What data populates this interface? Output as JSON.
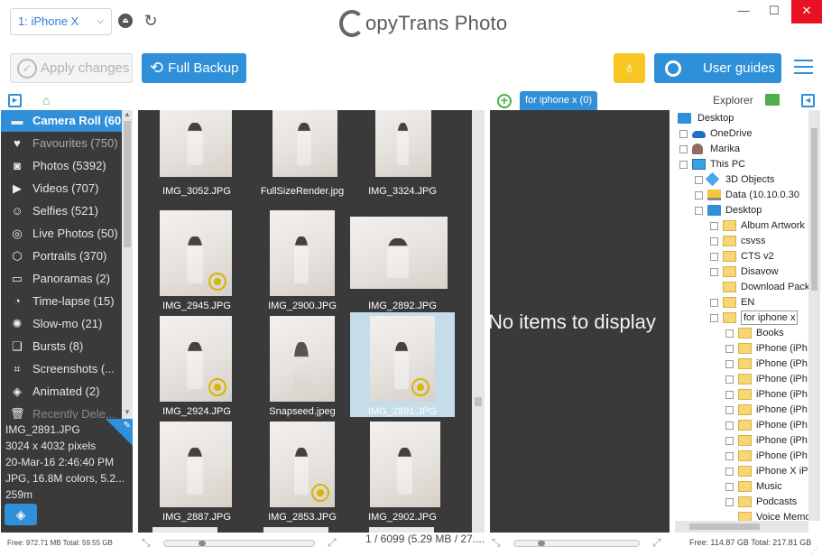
{
  "titlebar": {
    "device": "1: iPhone X",
    "logo_text": "opyTrans Photo",
    "minimize": "—",
    "maximize": "☐",
    "close": "✕"
  },
  "toolbar": {
    "apply_label": "Apply changes",
    "backup_label": "Full Backup",
    "guides_label": "User guides"
  },
  "subheader": {
    "album_tab": "for iphone x (0)",
    "explorer_label": "Explorer"
  },
  "sidebar": {
    "items": [
      {
        "label": "Camera Roll (60...",
        "icon": "camera-roll-icon",
        "glyph": "▬"
      },
      {
        "label": "Favourites (750)",
        "icon": "heart-icon",
        "glyph": "♥"
      },
      {
        "label": "Photos (5392)",
        "icon": "camera-icon",
        "glyph": "◙"
      },
      {
        "label": "Videos (707)",
        "icon": "video-icon",
        "glyph": "▶"
      },
      {
        "label": "Selfies (521)",
        "icon": "selfie-icon",
        "glyph": "☺"
      },
      {
        "label": "Live Photos (50)",
        "icon": "live-photo-icon",
        "glyph": "◎"
      },
      {
        "label": "Portraits (370)",
        "icon": "portrait-icon",
        "glyph": "⬡"
      },
      {
        "label": "Panoramas (2)",
        "icon": "panorama-icon",
        "glyph": "▭"
      },
      {
        "label": "Time-lapse (15)",
        "icon": "timelapse-icon",
        "glyph": "◔"
      },
      {
        "label": "Slow-mo (21)",
        "icon": "slowmo-icon",
        "glyph": "✺"
      },
      {
        "label": "Bursts (8)",
        "icon": "bursts-icon",
        "glyph": "❏"
      },
      {
        "label": "Screenshots (...",
        "icon": "screenshot-icon",
        "glyph": "⌗"
      },
      {
        "label": "Animated (2)",
        "icon": "animated-icon",
        "glyph": "◈"
      },
      {
        "label": "Recently Dele...",
        "icon": "trash-icon",
        "glyph": "🗑"
      }
    ]
  },
  "info": {
    "filename": "IMG_2891.JPG",
    "dimensions": "3024 x 4032 pixels",
    "date": "20-Mar-16 2:46:40 PM",
    "format": "JPG, 16.8M colors, 5.2...",
    "size": "259m",
    "storage": "Free: 972.71 MB Total: 59.55 GB"
  },
  "grid": {
    "photos": [
      {
        "name": "IMG_3052.JPG",
        "live": false,
        "selected": false
      },
      {
        "name": "FullSizeRender.jpg",
        "live": false,
        "selected": false
      },
      {
        "name": "IMG_3324.JPG",
        "live": false,
        "selected": false
      },
      {
        "name": "IMG_2945.JPG",
        "live": true,
        "selected": false
      },
      {
        "name": "IMG_2900.JPG",
        "live": false,
        "selected": false
      },
      {
        "name": "IMG_2892.JPG",
        "live": false,
        "selected": false
      },
      {
        "name": "IMG_2924.JPG",
        "live": true,
        "selected": false
      },
      {
        "name": "Snapseed.jpeg",
        "live": false,
        "selected": false
      },
      {
        "name": "IMG_2891.JPG",
        "live": true,
        "selected": true
      },
      {
        "name": "IMG_2887.JPG",
        "live": false,
        "selected": false
      },
      {
        "name": "IMG_2853.JPG",
        "live": true,
        "selected": false
      },
      {
        "name": "IMG_2902.JPG",
        "live": false,
        "selected": false
      }
    ],
    "count": "1 / 6099 (5.29 MB / 27...."
  },
  "album": {
    "empty_text": "No items to display"
  },
  "explorer": {
    "tree": [
      {
        "label": "Desktop",
        "icon": "desktop-icon",
        "expander": ""
      },
      {
        "label": "OneDrive",
        "icon": "onedrive-icon",
        "expander": "+"
      },
      {
        "label": "Marika",
        "icon": "user-icon",
        "expander": "+"
      },
      {
        "label": "This PC",
        "icon": "pc-icon",
        "expander": "−"
      },
      {
        "label": "3D Objects",
        "icon": "3d-objects-icon",
        "expander": "+"
      },
      {
        "label": "Data (10.10.0.30",
        "icon": "drive-icon",
        "expander": "+"
      },
      {
        "label": "Desktop",
        "icon": "desktop-icon",
        "expander": "−"
      },
      {
        "label": "Album Artwork",
        "icon": "folder-icon",
        "expander": "+"
      },
      {
        "label": "csvss",
        "icon": "folder-icon",
        "expander": "+"
      },
      {
        "label": "CTS v2",
        "icon": "folder-icon",
        "expander": "+"
      },
      {
        "label": "Disavow",
        "icon": "folder-icon",
        "expander": "+"
      },
      {
        "label": "Download Pack",
        "icon": "folder-icon",
        "expander": ""
      },
      {
        "label": "EN",
        "icon": "folder-icon",
        "expander": "+"
      },
      {
        "label": "for iphone x",
        "icon": "folder-icon",
        "expander": "−"
      },
      {
        "label": "Books",
        "icon": "folder-icon",
        "expander": "+"
      },
      {
        "label": "iPhone (iPh",
        "icon": "folder-icon",
        "expander": "+"
      },
      {
        "label": "iPhone (iPh",
        "icon": "folder-icon",
        "expander": "+"
      },
      {
        "label": "iPhone (iPh",
        "icon": "folder-icon",
        "expander": "+"
      },
      {
        "label": "iPhone (iPh",
        "icon": "folder-icon",
        "expander": "+"
      },
      {
        "label": "iPhone (iPh",
        "icon": "folder-icon",
        "expander": "+"
      },
      {
        "label": "iPhone (iPh",
        "icon": "folder-icon",
        "expander": "+"
      },
      {
        "label": "iPhone (iPh",
        "icon": "folder-icon",
        "expander": "+"
      },
      {
        "label": "iPhone (iPh",
        "icon": "folder-icon",
        "expander": "+"
      },
      {
        "label": "iPhone X iP",
        "icon": "folder-icon",
        "expander": "+"
      },
      {
        "label": "Music",
        "icon": "folder-icon",
        "expander": "+"
      },
      {
        "label": "Podcasts",
        "icon": "folder-icon",
        "expander": "+"
      },
      {
        "label": "Voice Memo",
        "icon": "folder-icon",
        "expander": ""
      }
    ],
    "storage": "Free: 114.87 GB Total: 217.81 GB"
  },
  "colors": {
    "accent": "#2f8fd8",
    "panel_dark": "#3a3a3a",
    "bulb": "#f7c623",
    "green": "#4cae4c",
    "live_badge": "#d7b600"
  }
}
